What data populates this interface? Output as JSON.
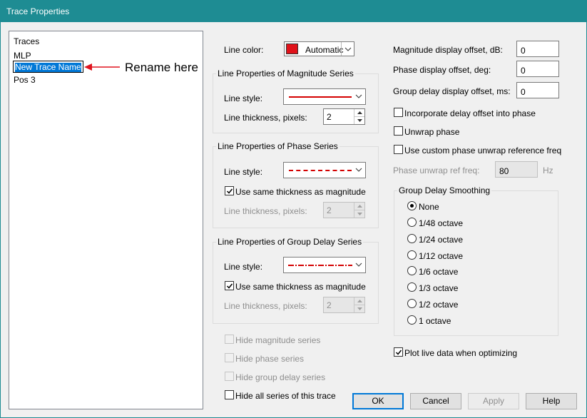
{
  "window": {
    "title": "Trace Properties"
  },
  "traces": {
    "header": "Traces",
    "items": [
      "MLP",
      "New Trace Name",
      "Pos 3"
    ],
    "annotation": "Rename here"
  },
  "line_color": {
    "label": "Line color:",
    "value": "Automatic",
    "swatch": "#e0121a"
  },
  "magnitude": {
    "group_title": "Line Properties of Magnitude Series",
    "style_label": "Line style:",
    "thickness_label": "Line thickness, pixels:",
    "thickness": "2",
    "line_color": "#d40000"
  },
  "phase": {
    "group_title": "Line Properties of Phase Series",
    "style_label": "Line style:",
    "same_thickness_label": "Use same thickness as magnitude",
    "thickness_label": "Line thickness, pixels:",
    "thickness": "2",
    "line_color": "#d40000"
  },
  "group_delay": {
    "group_title": "Line Properties of Group Delay Series",
    "style_label": "Line style:",
    "same_thickness_label": "Use same thickness as magnitude",
    "thickness_label": "Line thickness, pixels:",
    "thickness": "2",
    "line_color": "#d40000"
  },
  "hide": {
    "magnitude": "Hide magnitude series",
    "phase": "Hide phase series",
    "group_delay": "Hide group delay series",
    "all": "Hide all series of this trace"
  },
  "offsets": {
    "magnitude_label": "Magnitude display offset, dB:",
    "magnitude_value": "0",
    "phase_label": "Phase display offset, deg:",
    "phase_value": "0",
    "group_delay_label": "Group delay display offset, ms:",
    "group_delay_value": "0"
  },
  "options": {
    "incorporate_delay": "Incorporate delay offset into phase",
    "unwrap_phase": "Unwrap phase",
    "custom_unwrap": "Use custom phase unwrap reference freq",
    "unwrap_ref_label": "Phase unwrap ref freq:",
    "unwrap_ref_value": "80",
    "unwrap_ref_unit": "Hz"
  },
  "smoothing": {
    "group_title": "Group Delay Smoothing",
    "options": [
      "None",
      "1/48 octave",
      "1/24 octave",
      "1/12 octave",
      "1/6 octave",
      "1/3 octave",
      "1/2 octave",
      "1 octave"
    ],
    "selected": "None"
  },
  "plot_live": "Plot live data when optimizing",
  "buttons": {
    "ok": "OK",
    "cancel": "Cancel",
    "apply": "Apply",
    "help": "Help"
  }
}
